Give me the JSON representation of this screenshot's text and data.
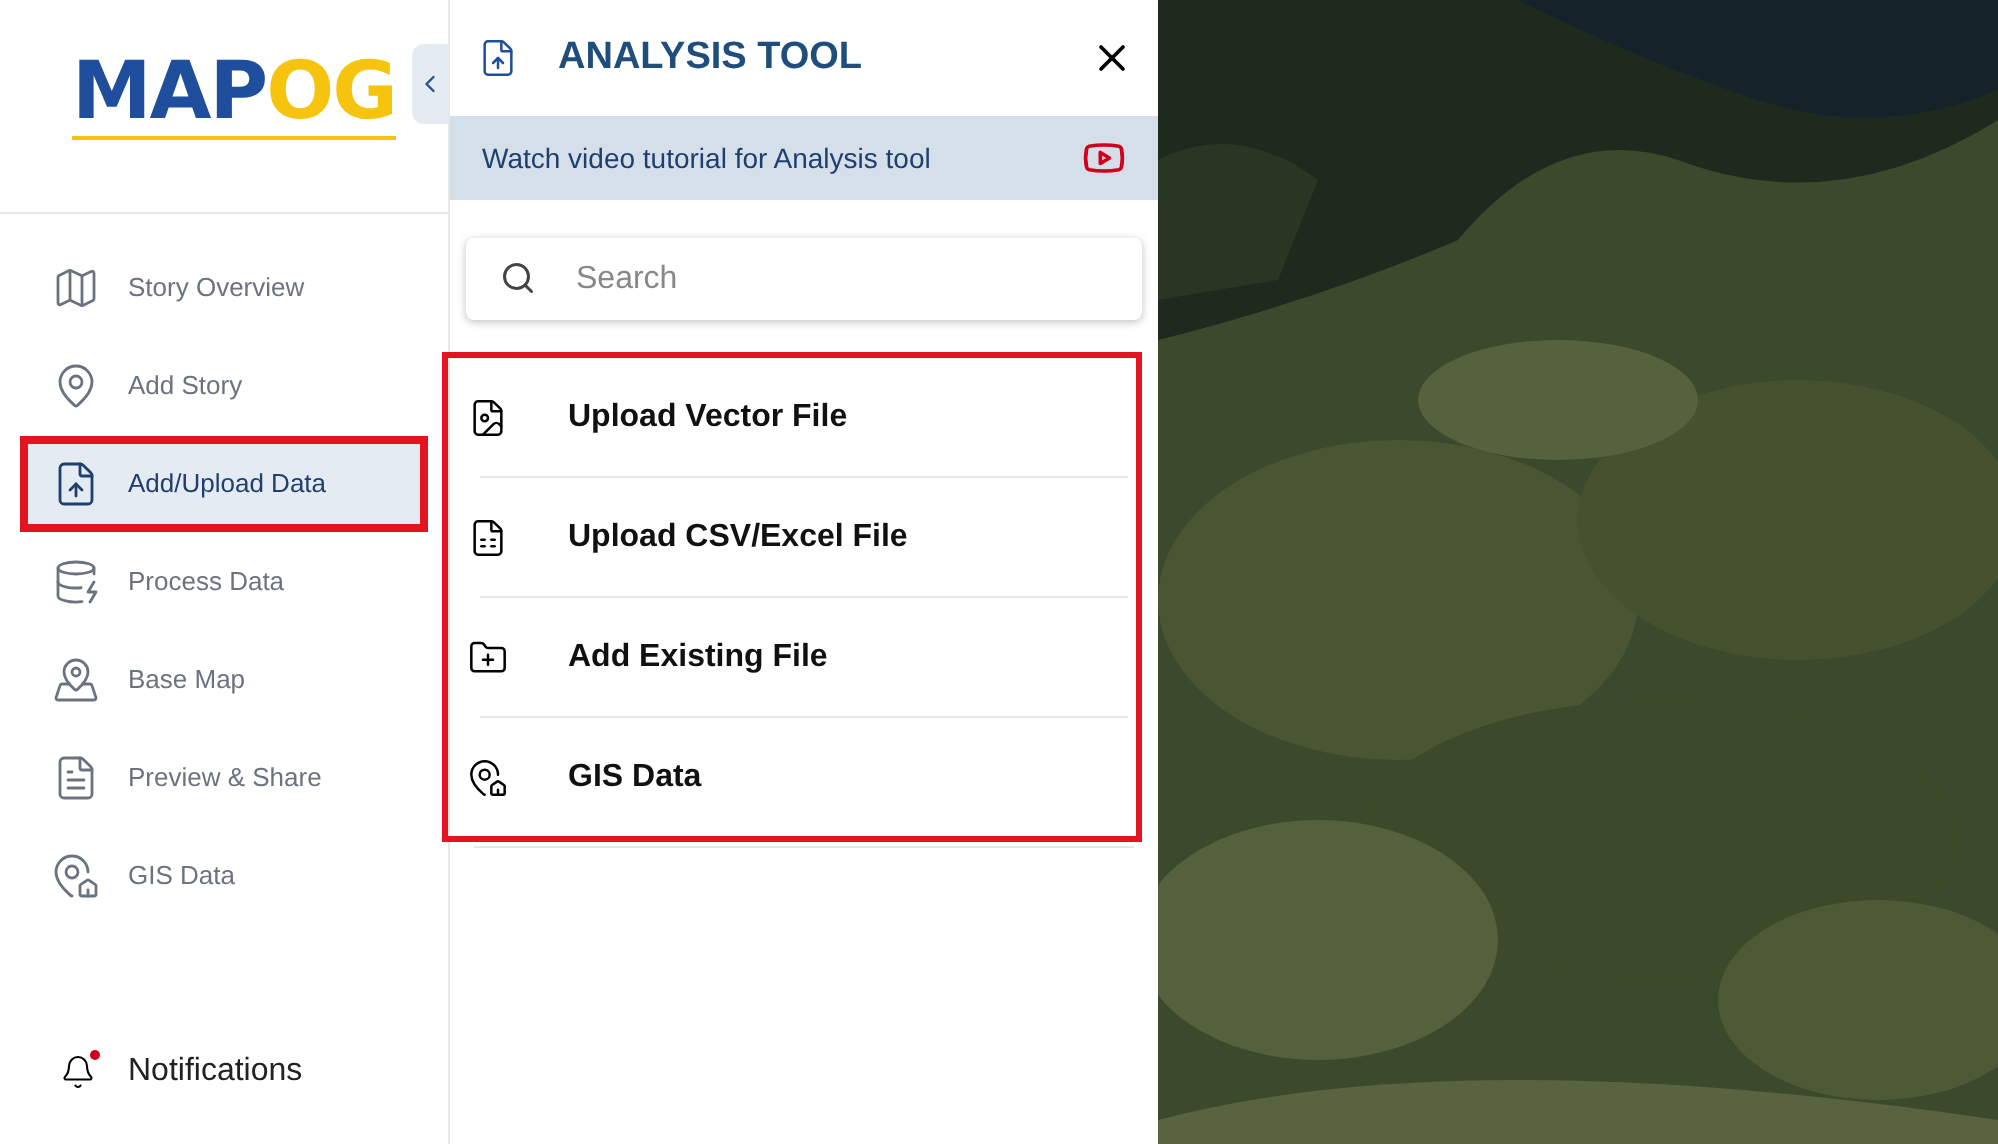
{
  "logo": {
    "part_1": "MAP",
    "part_2": "OG"
  },
  "sidebar": {
    "items": [
      {
        "label": "Story Overview",
        "selected": false
      },
      {
        "label": "Add Story",
        "selected": false
      },
      {
        "label": "Add/Upload Data",
        "selected": true
      },
      {
        "label": "Process Data",
        "selected": false
      },
      {
        "label": "Base Map",
        "selected": false
      },
      {
        "label": "Preview & Share",
        "selected": false
      },
      {
        "label": "GIS Data",
        "selected": false
      }
    ],
    "notifications": {
      "label": "Notifications",
      "unread": true
    }
  },
  "panel": {
    "title": "ANALYSIS TOOL",
    "tutorial": "Watch video tutorial for Analysis tool",
    "search": {
      "placeholder": "Search"
    },
    "options_highlighted": true,
    "options": [
      {
        "label": "Upload Vector File"
      },
      {
        "label": "Upload CSV/Excel File"
      },
      {
        "label": "Add Existing File"
      },
      {
        "label": "GIS Data"
      }
    ]
  }
}
